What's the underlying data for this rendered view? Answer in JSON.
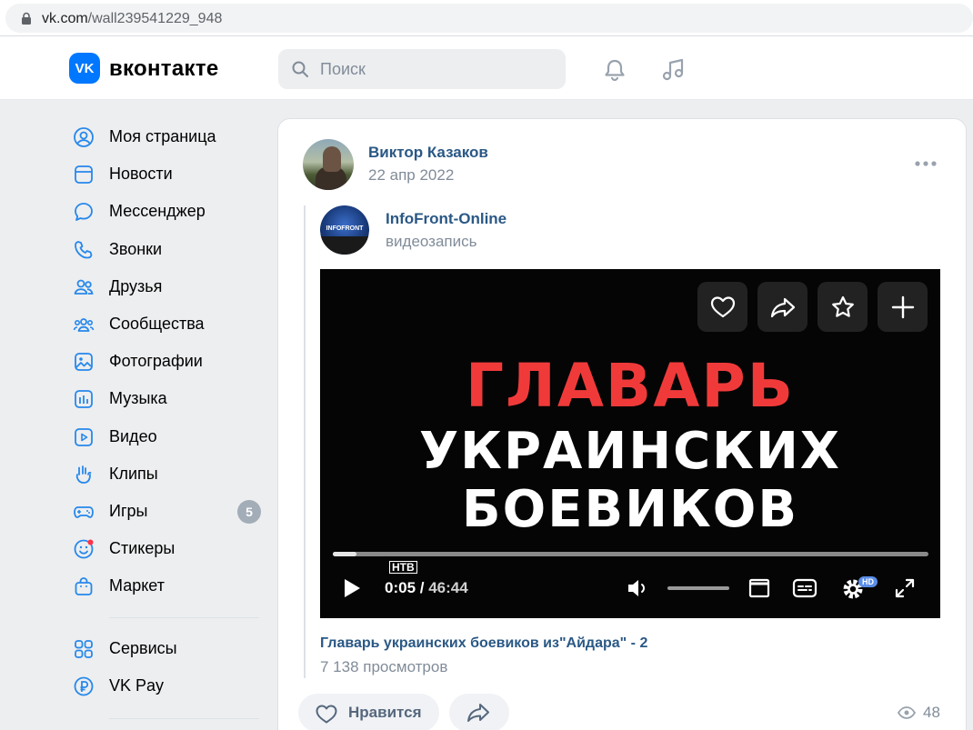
{
  "browser": {
    "url_host": "vk.com",
    "url_path": "/wall239541229_948"
  },
  "header": {
    "logo_mark": "VK",
    "logo_text": "вконтакте",
    "search_placeholder": "Поиск"
  },
  "sidebar": {
    "items": [
      {
        "label": "Моя страница",
        "icon": "user-circle-icon"
      },
      {
        "label": "Новости",
        "icon": "newsfeed-icon"
      },
      {
        "label": "Мессенджер",
        "icon": "message-bubble-icon"
      },
      {
        "label": "Звонки",
        "icon": "phone-icon"
      },
      {
        "label": "Друзья",
        "icon": "friends-icon"
      },
      {
        "label": "Сообщества",
        "icon": "communities-icon"
      },
      {
        "label": "Фотографии",
        "icon": "photo-icon"
      },
      {
        "label": "Музыка",
        "icon": "music-icon"
      },
      {
        "label": "Видео",
        "icon": "video-icon"
      },
      {
        "label": "Клипы",
        "icon": "clips-icon"
      },
      {
        "label": "Игры",
        "icon": "gamepad-icon",
        "badge": "5"
      },
      {
        "label": "Стикеры",
        "icon": "sticker-icon"
      },
      {
        "label": "Маркет",
        "icon": "market-bag-icon"
      }
    ],
    "secondary": [
      {
        "label": "Сервисы",
        "icon": "services-grid-icon"
      },
      {
        "label": "VK Pay",
        "icon": "vkpay-icon"
      }
    ]
  },
  "post": {
    "author": "Виктор Казаков",
    "date": "22 апр 2022",
    "repost": {
      "source_name": "InfoFront-Online",
      "source_avatar_text": "INFOFRONT",
      "source_type": "видеозапись",
      "video": {
        "title_lines": [
          "ГЛАВАРЬ",
          "УКРАИНСКИХ",
          "БОЕВИКОВ"
        ],
        "channel_badge": "НТВ",
        "current_time": "0:05",
        "duration": "46:44",
        "progress_fraction": 0.04,
        "hd_label": "HD"
      },
      "caption": "Главарь украинских боевиков из\"Айдара\" - 2",
      "views_text": "7 138 просмотров"
    },
    "actions": {
      "like_label": "Нравится",
      "view_count": "48"
    }
  },
  "colors": {
    "accent": "#0077ff",
    "link": "#2a5885",
    "muted": "#818c99",
    "video_red": "#f03a3a"
  }
}
